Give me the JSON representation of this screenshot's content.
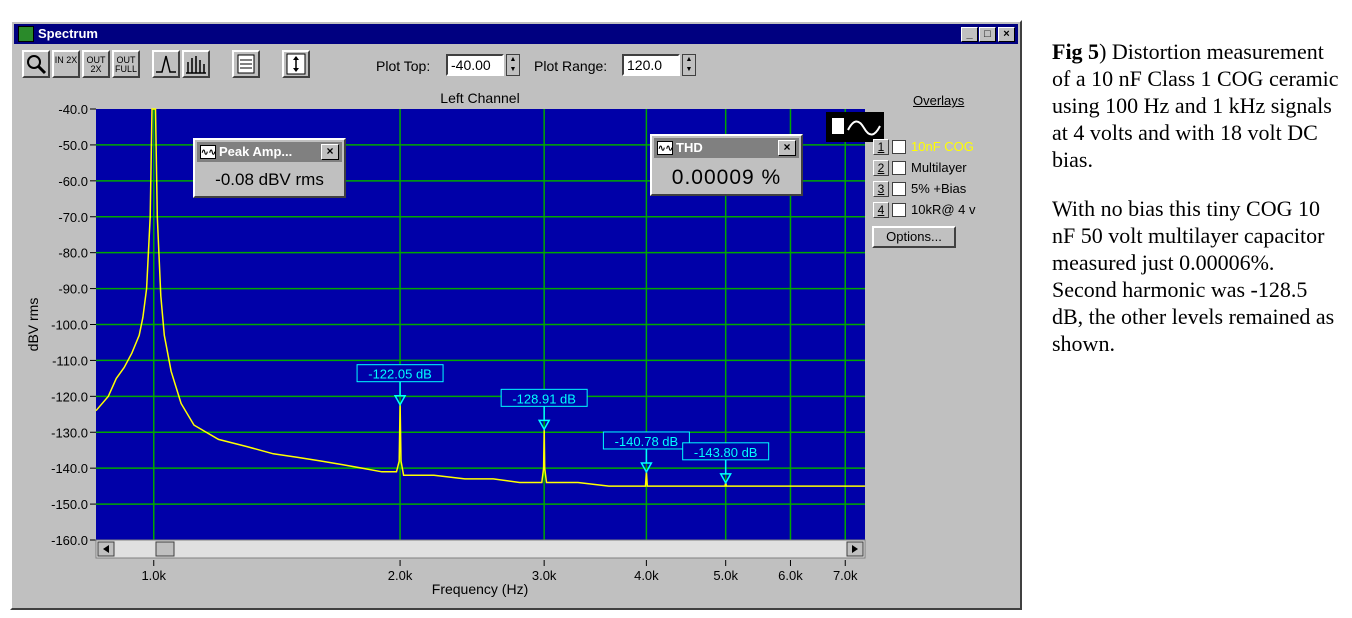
{
  "window": {
    "title": "Spectrum",
    "minimize_label": "_",
    "maximize_label": "□",
    "close_label": "×"
  },
  "toolbar": {
    "zoom_in_2x_label": "IN 2X",
    "zoom_out_2x_label": "OUT 2X",
    "zoom_out_full_label": "OUT FULL",
    "plot_top_label": "Plot Top:",
    "plot_top_value": "-40.00",
    "plot_range_label": "Plot Range:",
    "plot_range_value": "120.0"
  },
  "overlays": {
    "title": "Overlays",
    "items": [
      {
        "num": "1",
        "label": "10nF COG",
        "color": "#ffff00"
      },
      {
        "num": "2",
        "label": "Multilayer",
        "color": "#000000"
      },
      {
        "num": "3",
        "label": "5% +Bias",
        "color": "#000000"
      },
      {
        "num": "4",
        "label": "10kR@ 4 v",
        "color": "#000000"
      }
    ],
    "options_label": "Options..."
  },
  "peak_popup": {
    "title": "Peak Amp...",
    "value": "-0.08 dBV rms",
    "close": "×"
  },
  "thd_popup": {
    "title": "THD",
    "value": "0.00009 %",
    "close": "×"
  },
  "colors": {
    "plot_bg": "#0000a8",
    "grid": "#00a800",
    "trace": "#ffff00",
    "marker": "#00ffff"
  },
  "chart_data": {
    "type": "line",
    "title": "Left Channel",
    "xlabel": "Frequency (Hz)",
    "ylabel": "dBV rms",
    "x_scale": "log",
    "xlim": [
      850,
      7400
    ],
    "ylim": [
      -160,
      -40
    ],
    "grid": true,
    "y_ticks": [
      -40,
      -50,
      -60,
      -70,
      -80,
      -90,
      -100,
      -110,
      -120,
      -130,
      -140,
      -150,
      -160
    ],
    "y_tick_labels": [
      "-40.0",
      "-50.0",
      "-60.0",
      "-70.0",
      "-80.0",
      "-90.0",
      "-100.0",
      "-110.0",
      "-120.0",
      "-130.0",
      "-140.0",
      "-150.0",
      "-160.0"
    ],
    "x_ticks": [
      1000,
      2000,
      3000,
      4000,
      5000,
      6000,
      7000
    ],
    "x_tick_labels": [
      "1.0k",
      "2.0k",
      "3.0k",
      "4.0k",
      "5.0k",
      "6.0k",
      "7.0k"
    ],
    "series": [
      {
        "x": [
          850,
          880,
          900,
          920,
          940,
          960,
          970,
          980,
          990,
          995,
          1000,
          1005,
          1010,
          1020,
          1030,
          1050,
          1080,
          1120,
          1200,
          1300,
          1400,
          1500,
          1600,
          1700,
          1800,
          1900,
          1980,
          1995,
          2000,
          2005,
          2020,
          2200,
          2400,
          2600,
          2800,
          2980,
          2995,
          3000,
          3005,
          3020,
          3300,
          3600,
          3990,
          4000,
          4010,
          4500,
          4990,
          5000,
          5010,
          5500,
          6000,
          6500,
          7000,
          7400
        ],
        "y": [
          -124,
          -120,
          -115,
          -112,
          -108,
          -103,
          -98,
          -90,
          -70,
          -40,
          -40,
          -40,
          -70,
          -92,
          -103,
          -113,
          -122,
          -128,
          -132,
          -134,
          -136,
          -137,
          -138,
          -139,
          -140,
          -141,
          -141,
          -138,
          -122,
          -138,
          -142,
          -142,
          -143,
          -143,
          -144,
          -144,
          -140,
          -129,
          -140,
          -144,
          -144,
          -145,
          -145,
          -141,
          -145,
          -145,
          -145,
          -144,
          -145,
          -145,
          -145,
          -145,
          -145,
          -145
        ]
      }
    ],
    "markers": [
      {
        "x": 2000,
        "y": -122.05,
        "label": "-122.05 dB"
      },
      {
        "x": 3000,
        "y": -128.91,
        "label": "-128.91 dB"
      },
      {
        "x": 4000,
        "y": -140.78,
        "label": "-140.78 dB"
      },
      {
        "x": 5000,
        "y": -143.8,
        "label": "-143.80 dB"
      }
    ]
  },
  "caption": {
    "fig_label": "Fig 5",
    "fig_close": ")",
    "para1_rest": " Distortion measurement of a 10 nF Class 1 COG ceramic using 100 Hz and 1 kHz signals at 4 volts and with 18 volt DC bias.",
    "para2": "With no bias this tiny COG 10 nF 50 volt multilayer capacitor measured just 0.00006%. Second harmonic was -128.5 dB, the other levels remained as shown."
  }
}
